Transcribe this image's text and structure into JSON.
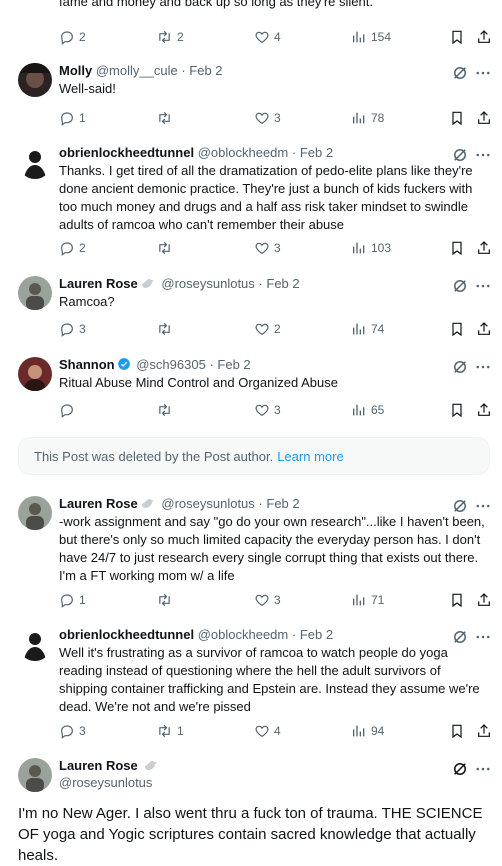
{
  "top_fragment": "fame and money and back up so long as they're silent.",
  "top_actions": {
    "replies": "2",
    "reposts": "2",
    "likes": "4",
    "views": "154"
  },
  "tweets": [
    {
      "name": "Molly",
      "handle": "@molly__cule",
      "date": "Feb 2",
      "text": "Well-said!",
      "replies": "1",
      "reposts": "",
      "likes": "3",
      "views": "78"
    },
    {
      "name": "obrienlockheedtunnel",
      "handle": "@oblockheedm",
      "date": "Feb 2",
      "text": "Thanks. I get tired of all the dramatization of pedo-elite plans like they're done ancient demonic practice. They're just a bunch of kids fuckers with too much money and drugs and a half ass risk taker mindset to swindle adults of ramcoa who can't remember their abuse",
      "replies": "2",
      "reposts": "",
      "likes": "3",
      "views": "103"
    },
    {
      "name": "Lauren Rose",
      "handle": "@roseysunlotus",
      "date": "Feb 2",
      "text": "Ramcoa?",
      "replies": "3",
      "reposts": "",
      "likes": "2",
      "views": "74"
    },
    {
      "name": "Shannon",
      "handle": "@sch96305",
      "date": "Feb 2",
      "text": "Ritual Abuse Mind Control and Organized Abuse",
      "replies": "",
      "reposts": "",
      "likes": "3",
      "views": "65"
    },
    {
      "name": "Lauren Rose",
      "handle": "@roseysunlotus",
      "date": "Feb 2",
      "text": "-work assignment and say \"go do your own research\"...like I haven't been, but there's only so much limited capacity the everyday person has. I don't have 24/7 to just research every single corrupt thing that exists out there. I'm a FT working mom w/ a life",
      "replies": "1",
      "reposts": "",
      "likes": "3",
      "views": "71"
    },
    {
      "name": "obrienlockheedtunnel",
      "handle": "@oblockheedm",
      "date": "Feb 2",
      "text": "Well it's frustrating as a survivor of ramcoa to watch people do yoga reading instead of questioning where the hell the adult survivors of shipping container trafficking and Epstein are. Instead they assume we're dead. We're not and we're pissed",
      "replies": "3",
      "reposts": "1",
      "likes": "4",
      "views": "94"
    }
  ],
  "deleted_notice": {
    "text": "This Post was deleted by the Post author.",
    "link": "Learn more"
  },
  "main_post": {
    "name": "Lauren Rose",
    "handle": "@roseysunlotus",
    "text": "I'm no New Ager. I also went thru a fuck ton of trauma. THE SCIENCE OF yoga and Yogic scriptures contain sacred knowledge that actually heals."
  },
  "colors": {
    "accent": "#1d9bf0",
    "muted": "#536471",
    "text": "#0f1419"
  }
}
